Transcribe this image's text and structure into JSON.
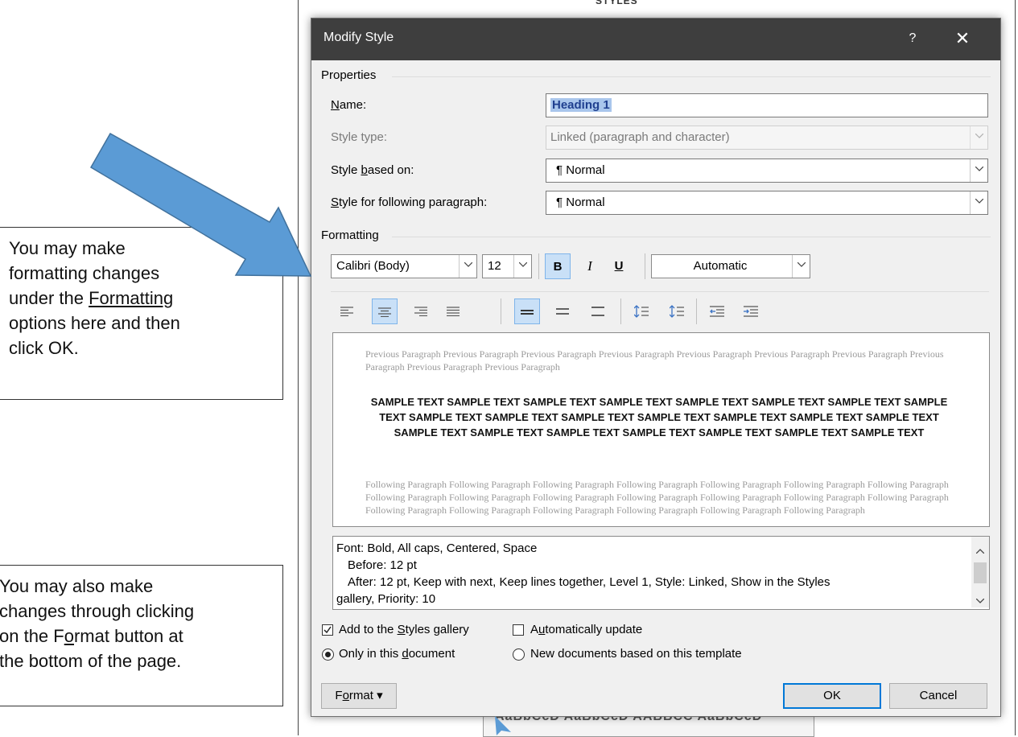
{
  "background": {
    "pane_title": "STYLES",
    "gallery_text": "AaBbCcD  AaBbCcD  AABBCC  AaBbCcD"
  },
  "callouts": {
    "first": {
      "line1": "You may make",
      "line2": "formatting changes",
      "line3_prefix": "under the ",
      "line3_link": "Formatting",
      "line4": "options here and then",
      "line5": "click OK."
    },
    "second": {
      "line1": "You may also make",
      "line2": "changes through clicking",
      "line3_prefix": "on the F",
      "line3_u": "o",
      "line3_suffix": "rmat button at",
      "line4": "the bottom of the page."
    }
  },
  "dialog": {
    "title": "Modify Style",
    "help": "?",
    "close": "✕",
    "properties": {
      "label": "Properties",
      "name_label_u": "N",
      "name_label_rest": "ame:",
      "name_value": "Heading 1",
      "style_type_label": "Style type:",
      "style_type_value": "Linked (paragraph and character)",
      "based_on_label_prefix": "Style ",
      "based_on_label_u": "b",
      "based_on_label_rest": "ased on:",
      "based_on_value": "Normal",
      "following_label_u": "S",
      "following_label_rest": "tyle for following paragraph:",
      "following_value": "Normal",
      "pilcrow": "¶"
    },
    "formatting": {
      "label": "Formatting",
      "font": "Calibri (Body)",
      "size": "12",
      "bold": "B",
      "italic": "I",
      "underline": "U",
      "color": "Automatic"
    },
    "preview": {
      "previous": "Previous Paragraph Previous Paragraph Previous Paragraph Previous Paragraph Previous Paragraph Previous Paragraph Previous Paragraph Previous Paragraph Previous Paragraph Previous Paragraph",
      "sample": "SAMPLE TEXT SAMPLE TEXT SAMPLE TEXT SAMPLE TEXT SAMPLE TEXT SAMPLE TEXT SAMPLE TEXT SAMPLE TEXT SAMPLE TEXT SAMPLE TEXT SAMPLE TEXT SAMPLE TEXT SAMPLE TEXT SAMPLE TEXT SAMPLE TEXT SAMPLE TEXT SAMPLE TEXT SAMPLE TEXT SAMPLE TEXT SAMPLE TEXT SAMPLE TEXT SAMPLE TEXT",
      "following": "Following Paragraph Following Paragraph Following Paragraph Following Paragraph Following Paragraph Following Paragraph Following Paragraph Following Paragraph Following Paragraph Following Paragraph Following Paragraph Following Paragraph Following Paragraph Following Paragraph Following Paragraph Following Paragraph Following Paragraph Following Paragraph Following Paragraph Following Paragraph"
    },
    "description": {
      "line1": "Font: Bold, All caps, Centered, Space",
      "line2": "Before:  12 pt",
      "line3": "After:  12 pt, Keep with next, Keep lines together, Level 1, Style: Linked, Show in the Styles",
      "line4": "gallery, Priority: 10"
    },
    "options": {
      "add_gallery_prefix": "Add to the ",
      "add_gallery_u": "S",
      "add_gallery_rest": "tyles gallery",
      "add_gallery_checked": true,
      "auto_update_prefix": "A",
      "auto_update_u": "u",
      "auto_update_rest": "tomatically update",
      "only_doc_prefix": "Only in this ",
      "only_doc_u": "d",
      "only_doc_rest": "ocument",
      "new_docs": "New documents based on this template"
    },
    "buttons": {
      "format_prefix": "F",
      "format_u": "o",
      "format_rest": "rmat",
      "format_arrow": "▾",
      "ok": "OK",
      "cancel": "Cancel"
    }
  }
}
